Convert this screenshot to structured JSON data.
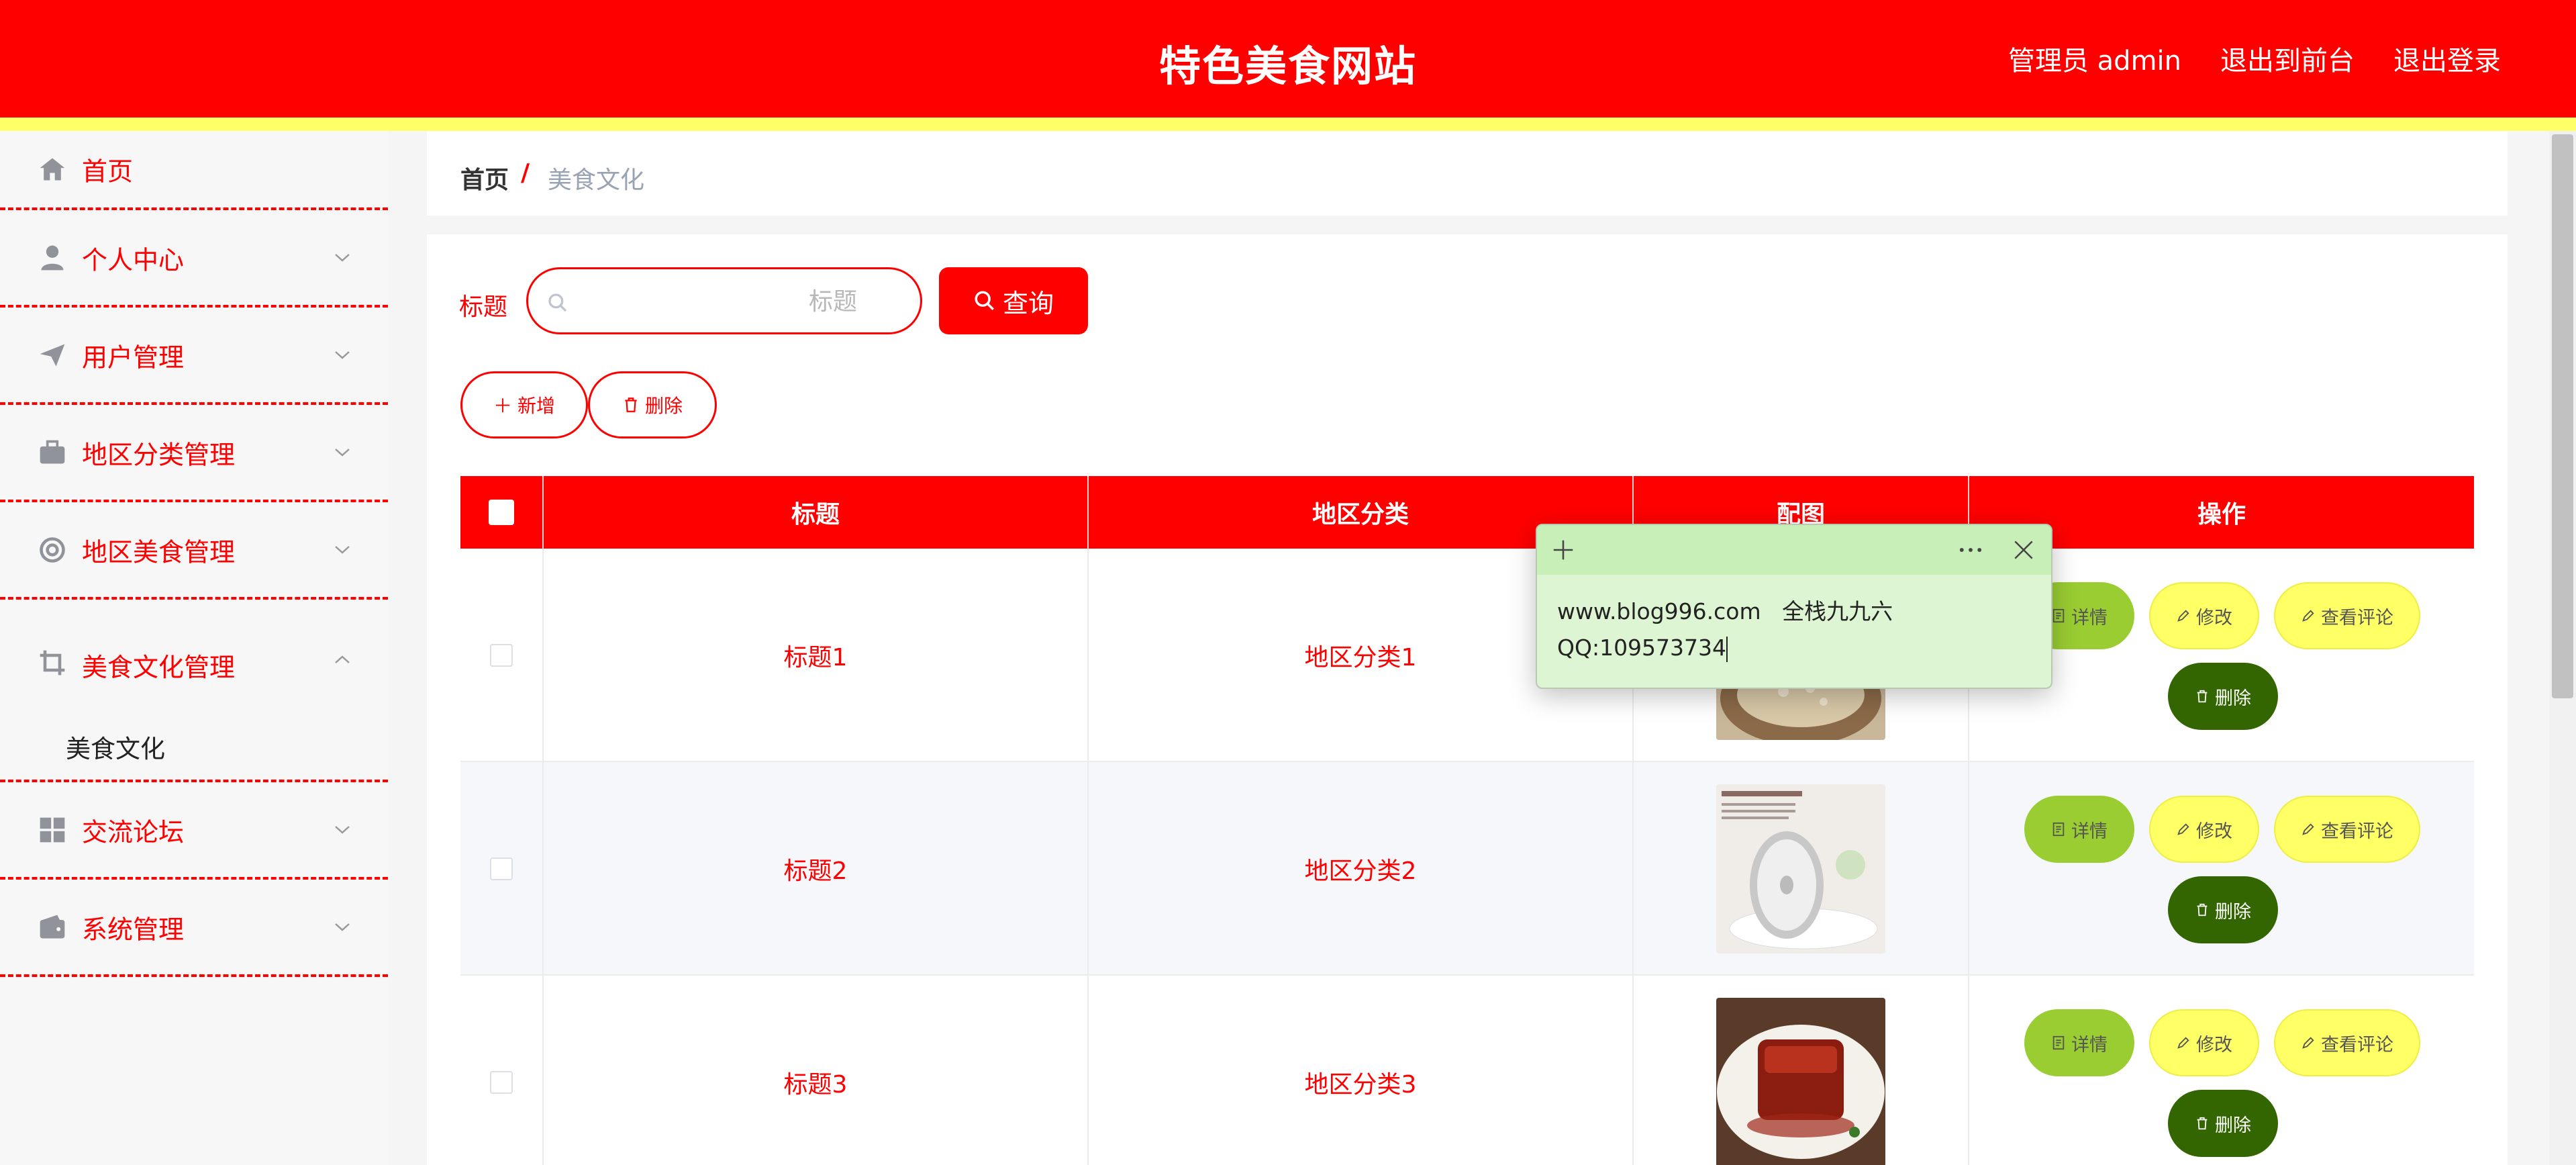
{
  "header": {
    "title": "特色美食网站",
    "user": "管理员 admin",
    "to_front": "退出到前台",
    "logout": "退出登录"
  },
  "sidebar": {
    "items": [
      {
        "label": "首页",
        "icon": "home-icon"
      },
      {
        "label": "个人中心",
        "icon": "user-icon"
      },
      {
        "label": "用户管理",
        "icon": "paper-plane-icon"
      },
      {
        "label": "地区分类管理",
        "icon": "briefcase-icon"
      },
      {
        "label": "地区美食管理",
        "icon": "lifebuoy-icon"
      },
      {
        "label": "美食文化管理",
        "icon": "crop-icon",
        "expanded": true,
        "children": [
          "美食文化"
        ]
      },
      {
        "label": "交流论坛",
        "icon": "grid-icon"
      },
      {
        "label": "系统管理",
        "icon": "wallet-icon"
      }
    ]
  },
  "breadcrumb": {
    "home": "首页",
    "separator": "/",
    "current": "美食文化"
  },
  "search": {
    "label": "标题",
    "placeholder": "标题",
    "query_button": "查询"
  },
  "toolbar": {
    "add": "新增",
    "delete": "删除"
  },
  "table": {
    "headers": [
      "标题",
      "地区分类",
      "配图",
      "操作"
    ],
    "rows": [
      {
        "title": "标题1",
        "category": "地区分类1",
        "image": "rice-dish-photo"
      },
      {
        "title": "标题2",
        "category": "地区分类2",
        "image": "fish-steak-photo"
      },
      {
        "title": "标题3",
        "category": "地区分类3",
        "image": "braised-pork-photo"
      }
    ],
    "actions": {
      "detail": "详情",
      "edit": "修改",
      "comments": "查看评论",
      "delete": "删除"
    }
  },
  "sticky_note": {
    "line1": "www.blog996.com   全栈九九六",
    "line2": "QQ:109573734"
  },
  "colors": {
    "primary": "#ff0000",
    "accent_yellow": "#ffff66",
    "detail_green": "#9acd32",
    "delete_green": "#336600",
    "note_bg": "#ddf5d2"
  }
}
